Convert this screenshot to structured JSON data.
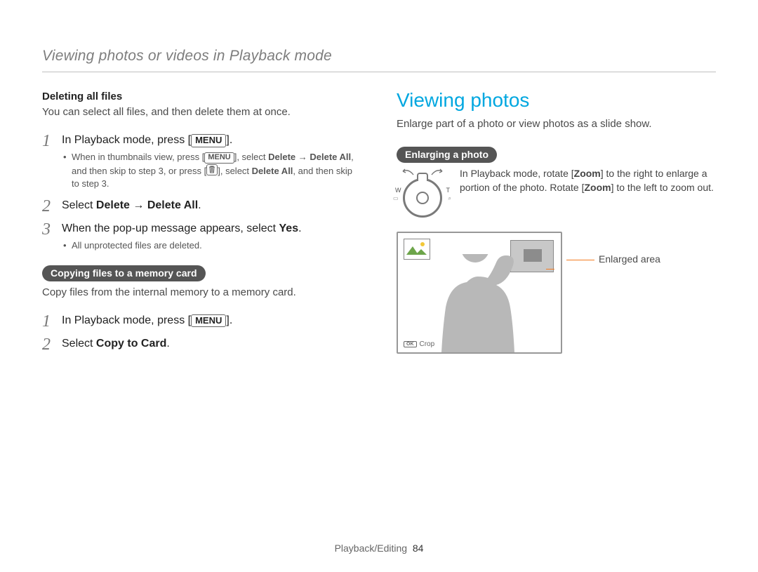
{
  "breadcrumb": "Viewing photos or videos in Playback mode",
  "left": {
    "heading_delete_all": "Deleting all files",
    "delete_all_desc": "You can select all files, and then delete them at once.",
    "step1_text_a": "In Playback mode, press [",
    "menu_label": "MENU",
    "step1_text_b": "].",
    "bullet1_a": "When in thumbnails view, press [",
    "bullet1_b": "], select ",
    "bullet1_bold1": "Delete → Delete All",
    "bullet1_c": ", and then skip to step 3, or press [",
    "bullet1_d": "], select ",
    "bullet1_bold2": "Delete All",
    "bullet1_e": ", and then skip to step 3.",
    "step2_a": "Select ",
    "step2_bold": "Delete → Delete All",
    "step2_b": ".",
    "step3_a": "When the pop-up message appears, select ",
    "step3_bold": "Yes",
    "step3_b": ".",
    "bullet3": "All unprotected files are deleted.",
    "pill_copy": "Copying files to a memory card",
    "copy_desc": "Copy files from the internal memory to a memory card.",
    "copy_step1_a": "In Playback mode, press [",
    "copy_step1_b": "].",
    "copy_step2_a": "Select ",
    "copy_step2_bold": "Copy to Card",
    "copy_step2_b": "."
  },
  "right": {
    "section_title": "Viewing photos",
    "section_desc": "Enlarge part of a photo or view photos as a slide show.",
    "pill_enlarge": "Enlarging a photo",
    "dial_W": "W",
    "dial_T": "T",
    "dial_wide_sym": "◻",
    "dial_tele_sym": "🔍",
    "zoom_instr_a": "In Playback mode, rotate [",
    "zoom_bold": "Zoom",
    "zoom_instr_b": "] to the right to enlarge a portion of the photo. Rotate [",
    "zoom_instr_c": "] to the left to zoom out.",
    "ok_label": "OK",
    "crop_label": "Crop",
    "callout": "Enlarged area"
  },
  "footer": {
    "section": "Playback/Editing",
    "page": "84"
  }
}
